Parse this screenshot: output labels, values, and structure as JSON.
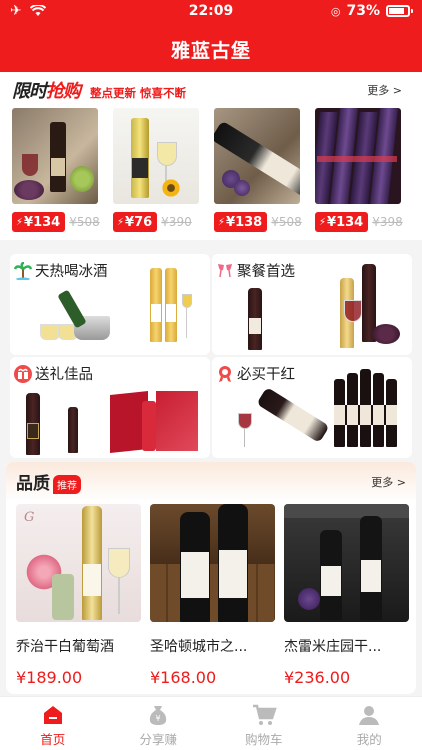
{
  "status": {
    "time": "22:09",
    "battery": "73%"
  },
  "header": {
    "title": "雅蓝古堡"
  },
  "flash_sale": {
    "logo_a": "限时",
    "logo_b": "抢购",
    "subtitle": "整点更新 惊喜不断",
    "more": "更多 >",
    "items": [
      {
        "price": "¥134",
        "old_price": "¥508"
      },
      {
        "price": "¥76",
        "old_price": "¥390"
      },
      {
        "price": "¥138",
        "old_price": "¥508"
      },
      {
        "price": "¥134",
        "old_price": "¥398"
      }
    ]
  },
  "categories": [
    {
      "label": "天热喝冰酒",
      "icon": "palm-tree-icon"
    },
    {
      "label": "聚餐首选",
      "icon": "cheers-icon"
    },
    {
      "label": "送礼佳品",
      "icon": "gift-icon"
    },
    {
      "label": "必买干红",
      "icon": "medal-icon"
    }
  ],
  "quality": {
    "title": "品质",
    "badge": "推荐",
    "more": "更多 >",
    "products": [
      {
        "name": "乔治干白葡萄酒",
        "price": "¥189.00"
      },
      {
        "name": "圣哈顿城市之...",
        "price": "¥168.00"
      },
      {
        "name": "杰雷米庄园干...",
        "price": "¥236.00"
      }
    ]
  },
  "tabbar": [
    {
      "label": "首页",
      "icon": "home-icon",
      "active": true
    },
    {
      "label": "分享赚",
      "icon": "money-bag-icon",
      "active": false
    },
    {
      "label": "购物车",
      "icon": "cart-icon",
      "active": false
    },
    {
      "label": "我的",
      "icon": "user-icon",
      "active": false
    }
  ],
  "colors": {
    "accent": "#ee1c1c"
  }
}
